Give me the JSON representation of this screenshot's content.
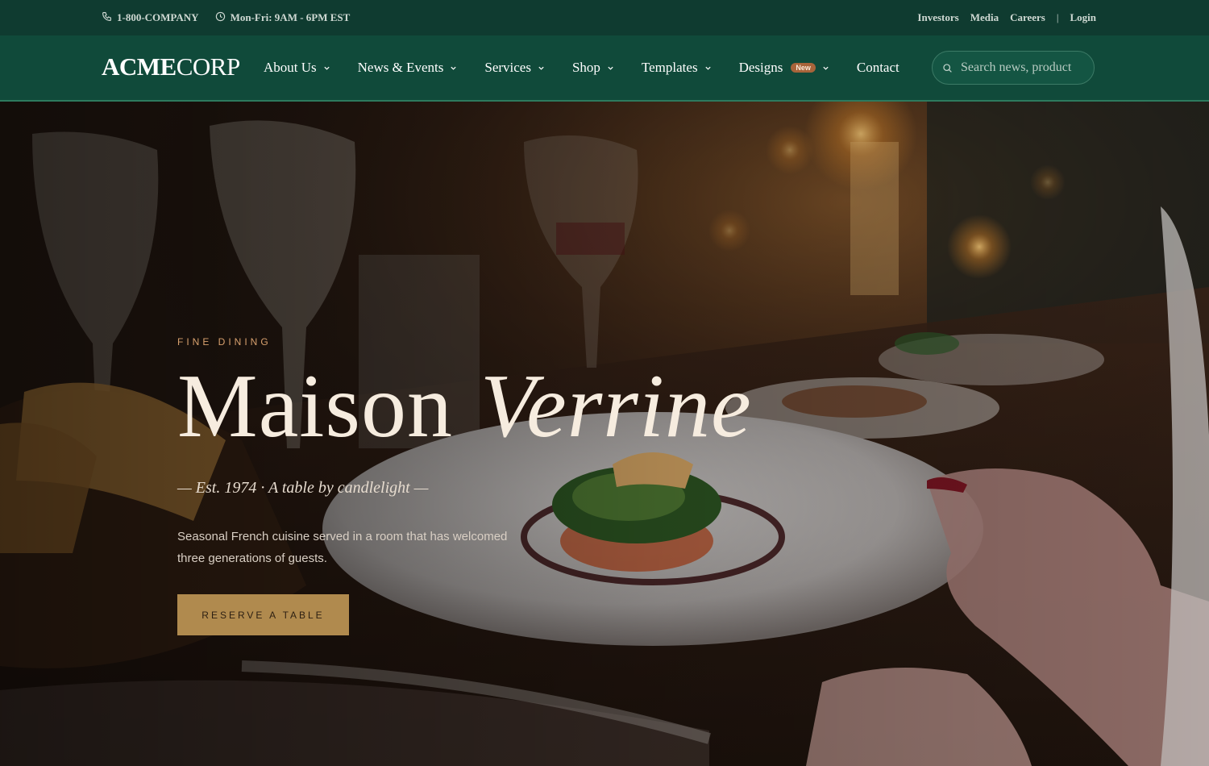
{
  "topbar": {
    "phone": "1-800-COMPANY",
    "hours": "Mon-Fri: 9AM - 6PM EST",
    "links": [
      "Investors",
      "Media",
      "Careers"
    ],
    "separator": "|",
    "login": "Login"
  },
  "nav": {
    "logo_bold": "ACME",
    "logo_regular": "CORP",
    "items": [
      {
        "label": "About Us"
      },
      {
        "label": "News & Events"
      },
      {
        "label": "Services"
      },
      {
        "label": "Shop"
      },
      {
        "label": "Templates"
      },
      {
        "label": "Designs",
        "badge": "New"
      },
      {
        "label": "Contact"
      }
    ],
    "search_placeholder": "Search news, product"
  },
  "hero": {
    "eyebrow": "FINE DINING",
    "title_regular": "Maison",
    "title_italic": "Verrine",
    "tagline": "— Est. 1974 · A table by candlelight —",
    "description": "Seasonal French cuisine served in a room that has welcomed three generations of guests.",
    "cta_label": "RESERVE A TABLE"
  },
  "colors": {
    "topbar_bg": "#0f3b30",
    "nav_bg": "#104a3a",
    "accent_gold": "#b08a4e",
    "eyebrow": "#d7a06d",
    "badge": "#a8643a"
  }
}
